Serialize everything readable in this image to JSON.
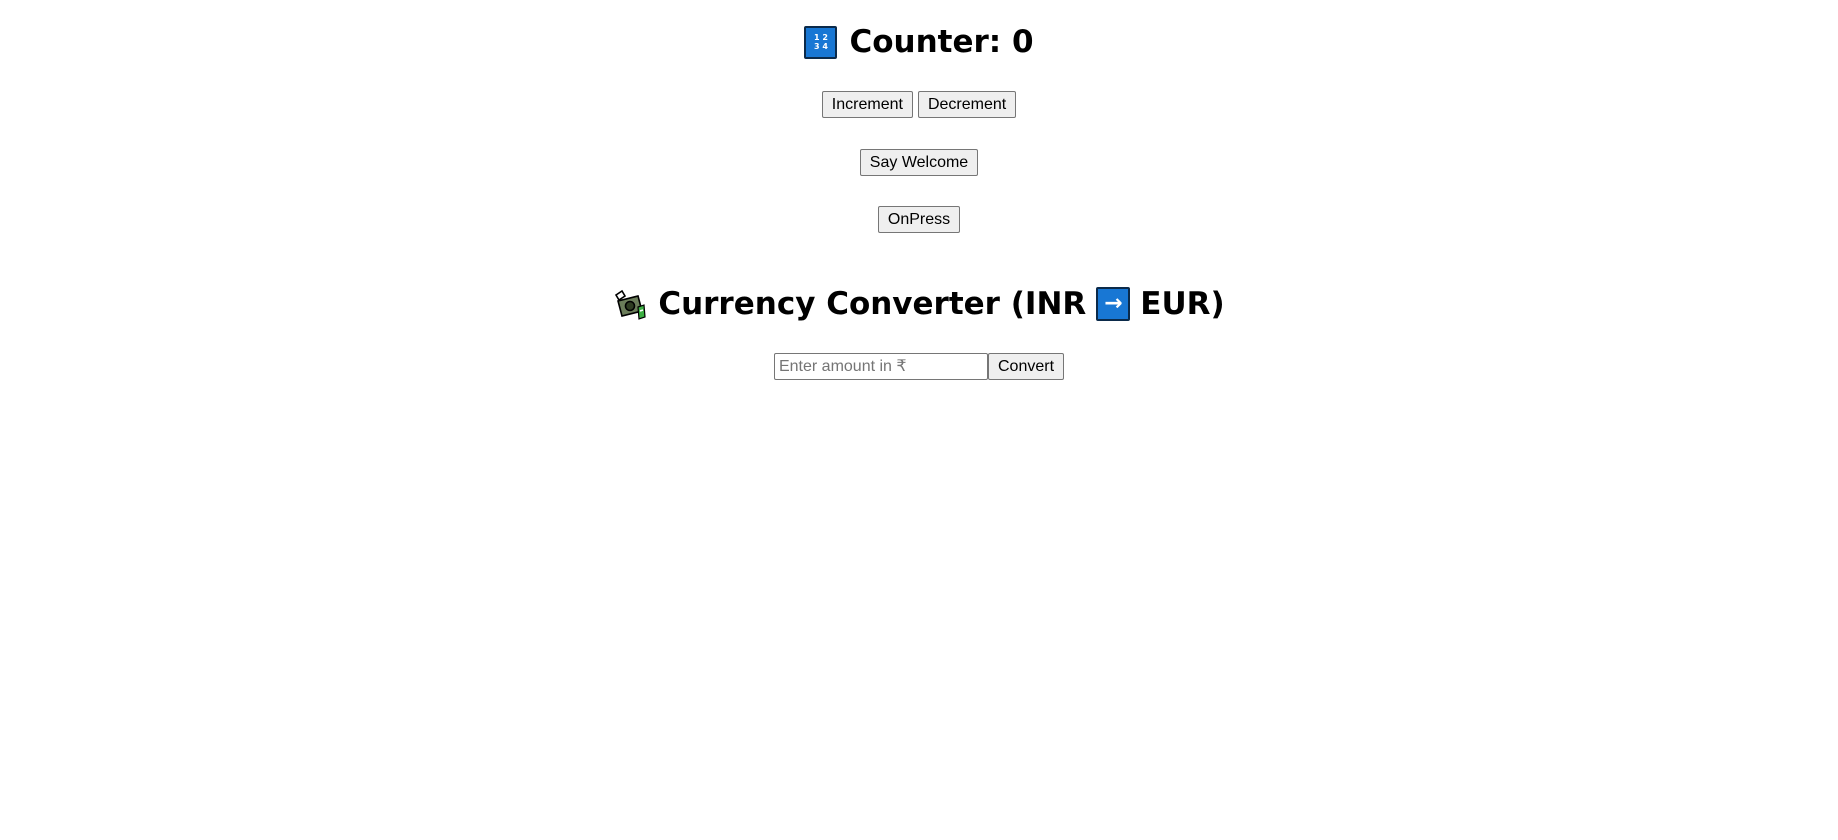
{
  "counter": {
    "title": "Counter: 0",
    "icon": "input-numbers-icon",
    "icon_digits_top": "1 2",
    "icon_digits_bottom": "3 4",
    "increment_label": "Increment",
    "decrement_label": "Decrement"
  },
  "welcome": {
    "button_label": "Say Welcome"
  },
  "onpress": {
    "button_label": "OnPress"
  },
  "converter": {
    "icon": "money-with-wings-icon",
    "title_prefix": "Currency Converter (INR",
    "arrow_icon": "right-arrow-icon",
    "title_suffix": "EUR)",
    "input_placeholder": "Enter amount in ₹",
    "input_value": "",
    "convert_label": "Convert"
  },
  "colors": {
    "icon_blue": "#1877d4",
    "button_bg": "#efefef",
    "button_border": "#767676"
  }
}
